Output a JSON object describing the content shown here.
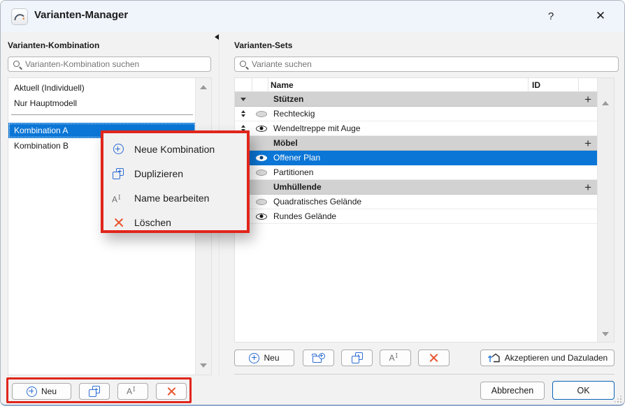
{
  "window": {
    "title": "Varianten-Manager",
    "help": "?",
    "close": "✕"
  },
  "left_panel": {
    "title": "Varianten-Kombination",
    "search_placeholder": "Varianten-Kombination suchen",
    "items": [
      {
        "label": "Aktuell (Individuell)",
        "selected": false
      },
      {
        "label": "Nur Hauptmodell",
        "selected": false
      },
      {
        "label": "Kombination A",
        "selected": true
      },
      {
        "label": "Kombination B",
        "selected": false
      }
    ],
    "new_button_label": "Neu"
  },
  "context_menu": {
    "items": [
      {
        "label": "Neue Kombination",
        "icon": "plus-circle-icon"
      },
      {
        "label": "Duplizieren",
        "icon": "duplicate-icon"
      },
      {
        "label": "Name bearbeiten",
        "icon": "rename-icon"
      },
      {
        "label": "Löschen",
        "icon": "delete-x-icon"
      }
    ]
  },
  "right_panel": {
    "title": "Varianten-Sets",
    "search_placeholder": "Variante suchen",
    "table": {
      "columns": [
        "Name",
        "ID"
      ],
      "add_label": "+",
      "rows": [
        {
          "type": "group",
          "name": "Stützen"
        },
        {
          "type": "variant",
          "name": "Rechteckig",
          "eye": "closed",
          "selected": false
        },
        {
          "type": "variant",
          "name": "Wendeltreppe mit Auge",
          "eye": "open",
          "selected": false
        },
        {
          "type": "group",
          "name": "Möbel"
        },
        {
          "type": "variant",
          "name": "Offener Plan",
          "eye": "open",
          "selected": true
        },
        {
          "type": "variant",
          "name": "Partitionen",
          "eye": "closed",
          "selected": false
        },
        {
          "type": "group",
          "name": "Umhüllende"
        },
        {
          "type": "variant",
          "name": "Quadratisches Gelände",
          "eye": "closed",
          "selected": false
        },
        {
          "type": "variant",
          "name": "Rundes Gelände",
          "eye": "open",
          "selected": false
        }
      ]
    },
    "new_button_label": "Neu",
    "accept_button_label": "Akzeptieren und Dazuladen"
  },
  "footer": {
    "cancel_label": "Abbrechen",
    "ok_label": "OK"
  },
  "colors": {
    "selection": "#0b76d6",
    "annotation_red": "#e1251b",
    "icon_blue": "#2b6cd4",
    "delete_orange": "#e8552e",
    "group_row_gray": "#d2d2d2",
    "titlebar": "#f0f4fb"
  }
}
